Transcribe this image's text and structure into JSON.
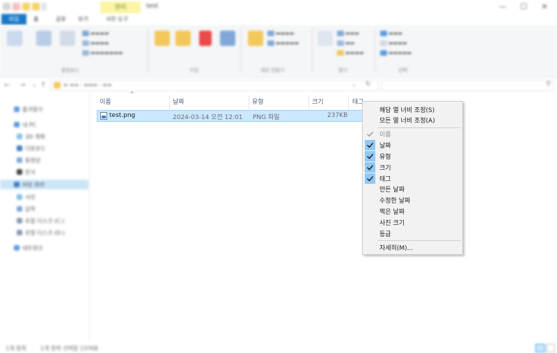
{
  "window": {
    "title": "test",
    "contextual_tab": "관리",
    "minimize_glyph": "—",
    "maximize_glyph": "☐",
    "close_glyph": "✕"
  },
  "menu_tabs": [
    "파일",
    "홈",
    "공유",
    "보기",
    "사진 도구"
  ],
  "ribbon": {
    "groups": [
      "클립보드",
      "구성",
      "새로 만들기",
      "열기",
      "선택"
    ]
  },
  "navigation": {
    "items": [
      "즐겨찾기",
      "내 PC",
      "3D 개체",
      "다운로드",
      "동영상",
      "문서",
      "바탕 화면",
      "사진",
      "음악",
      "로컬 디스크 (C:)",
      "로컬 디스크 (D:)",
      "네트워크"
    ],
    "selected_index": 6
  },
  "file_list": {
    "columns": [
      "이름",
      "날짜",
      "유형",
      "크기",
      "태그"
    ],
    "rows": [
      {
        "name": "test.png",
        "date": "2024-03-14 오전 12:01",
        "type": "PNG 파일",
        "size": "237KB"
      }
    ]
  },
  "context_menu": {
    "top_items": [
      "해당 열 너비 조정(S)",
      "모든 열 너비 조정(A)"
    ],
    "column_items": [
      {
        "label": "이름",
        "checked": true,
        "disabled": true
      },
      {
        "label": "날짜",
        "checked": true,
        "disabled": false
      },
      {
        "label": "유형",
        "checked": true,
        "disabled": false
      },
      {
        "label": "크기",
        "checked": true,
        "disabled": false
      },
      {
        "label": "태그",
        "checked": true,
        "disabled": false
      },
      {
        "label": "만든 날짜",
        "checked": false,
        "disabled": false
      },
      {
        "label": "수정한 날짜",
        "checked": false,
        "disabled": false
      },
      {
        "label": "찍은 날짜",
        "checked": false,
        "disabled": false
      },
      {
        "label": "사진 크기",
        "checked": false,
        "disabled": false
      },
      {
        "label": "등급",
        "checked": false,
        "disabled": false
      }
    ],
    "more_item": "자세히(M)..."
  },
  "status": {
    "item_count": "1개 항목",
    "selection": "1개 항목 선택함 237KB"
  },
  "colors": {
    "accent": "#1979ca",
    "selection": "#cce8ff",
    "check_bg": "#90c8f6",
    "tool_tab": "#fbf5a5"
  }
}
